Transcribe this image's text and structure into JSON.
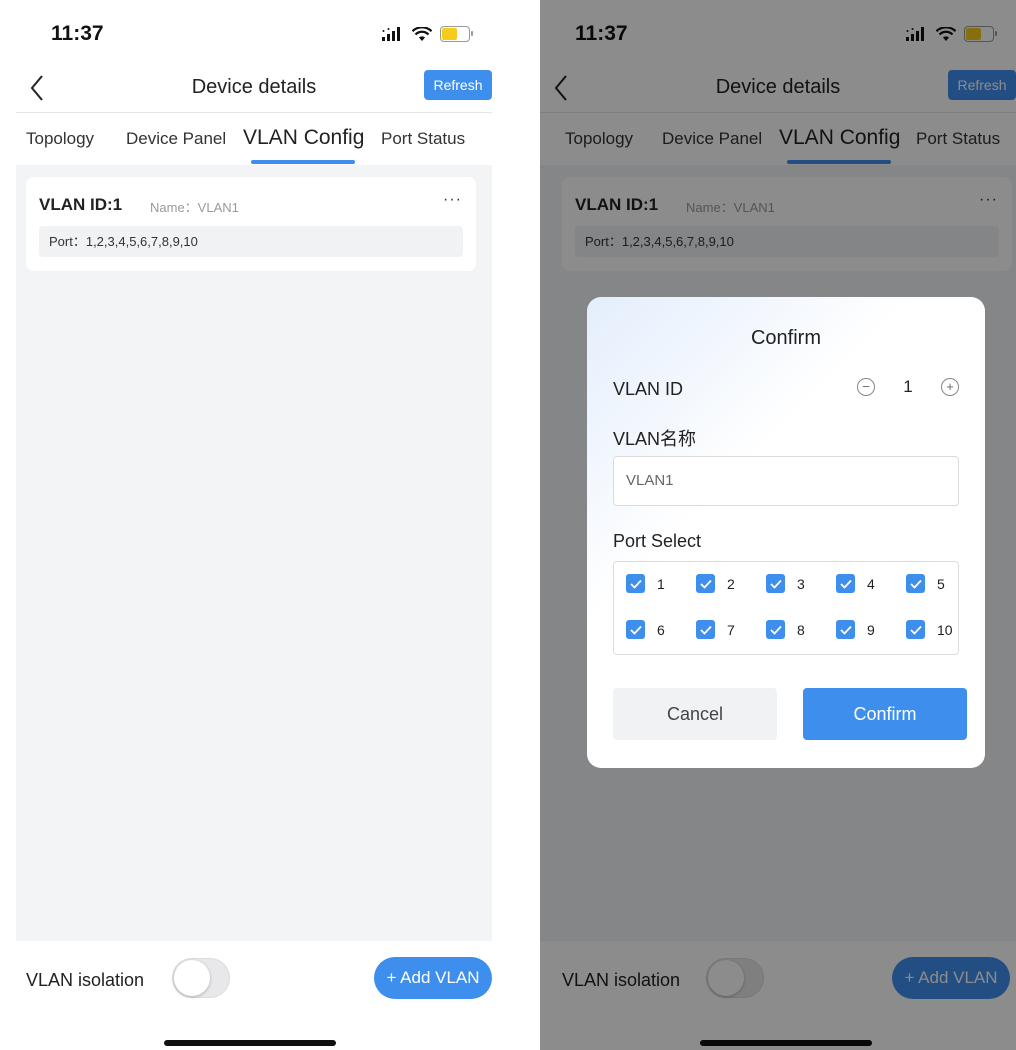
{
  "status": {
    "time": "11:37"
  },
  "header": {
    "title": "Device details",
    "refresh_label": "Refresh"
  },
  "tabs": [
    {
      "label": "Topology"
    },
    {
      "label": "Device Panel"
    },
    {
      "label": "VLAN Config",
      "active": true
    },
    {
      "label": "Port Status"
    }
  ],
  "vlan_card": {
    "id_label": "VLAN ID:1",
    "name_label": "Name：VLAN1",
    "port_label": "Port：1,2,3,4,5,6,7,8,9,10",
    "more_label": "···"
  },
  "footer": {
    "isolation_label": "VLAN isolation",
    "isolation_on": false,
    "add_label": "+ Add VLAN"
  },
  "modal": {
    "title": "Confirm",
    "vlan_id_label": "VLAN ID",
    "vlan_id_value": "1",
    "minus_label": "−",
    "plus_label": "+",
    "name_label": "VLAN名称",
    "name_value": "VLAN1",
    "port_select_label": "Port Select",
    "ports": [
      {
        "label": "1",
        "checked": true
      },
      {
        "label": "2",
        "checked": true
      },
      {
        "label": "3",
        "checked": true
      },
      {
        "label": "4",
        "checked": true
      },
      {
        "label": "5",
        "checked": true
      },
      {
        "label": "6",
        "checked": true
      },
      {
        "label": "7",
        "checked": true
      },
      {
        "label": "8",
        "checked": true
      },
      {
        "label": "9",
        "checked": true
      },
      {
        "label": "10",
        "checked": true
      }
    ],
    "cancel_label": "Cancel",
    "confirm_label": "Confirm"
  },
  "colors": {
    "accent": "#3e8eee",
    "battery": "#f5cc1b",
    "background": "#f3f4f6"
  }
}
